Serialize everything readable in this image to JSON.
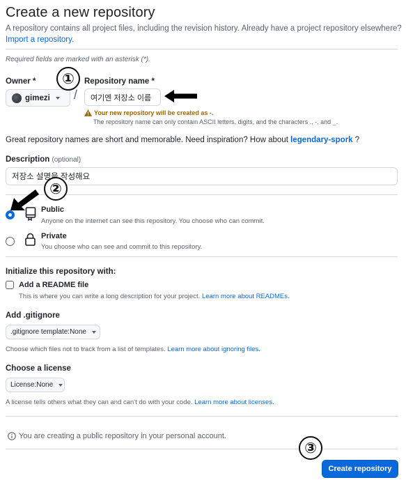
{
  "header": {
    "title": "Create a new repository",
    "intro": "A repository contains all project files, including the revision history. Already have a project repository elsewhere?",
    "import_link": "Import a repository."
  },
  "required_note": "Required fields are marked with an asterisk (*).",
  "owner": {
    "label": "Owner *",
    "value": "gimezi"
  },
  "slash": "/",
  "repo_name": {
    "label": "Repository name *",
    "value": "여기엔 저장소 이름"
  },
  "warning": {
    "main": "Your new repository will be created as -.",
    "sub": "The repository name can only contain ASCII letters, digits, and the characters ., -, and _."
  },
  "suggestion": {
    "prefix": "Great repository names are short and memorable. Need inspiration? How about ",
    "name": "legendary-spork",
    "suffix": " ?"
  },
  "description": {
    "label": "Description",
    "optional": "(optional)",
    "value": "저장소 설명을 작성해요"
  },
  "visibility": {
    "public": {
      "title": "Public",
      "desc": "Anyone on the internet can see this repository. You choose who can commit.",
      "selected": true
    },
    "private": {
      "title": "Private",
      "desc": "You choose who can see and commit to this repository.",
      "selected": false
    }
  },
  "init": {
    "heading": "Initialize this repository with:",
    "readme_label": "Add a README file",
    "readme_desc": "This is where you can write a long description for your project.",
    "readme_link": "Learn more about READMEs."
  },
  "gitignore": {
    "heading": "Add .gitignore",
    "select_prefix": ".gitignore template:",
    "select_value": "None",
    "desc": "Choose which files not to track from a list of templates.",
    "link": "Learn more about ignoring files."
  },
  "license": {
    "heading": "Choose a license",
    "select_prefix": "License:",
    "select_value": "None",
    "desc": "A license tells others what they can and can't do with your code.",
    "link": "Learn more about licenses."
  },
  "notice": "You are creating a public repository in your personal account.",
  "submit_label": "Create repository",
  "annotations": {
    "step1": "①",
    "step2": "②",
    "step3": "③"
  },
  "colors": {
    "accent": "#0969da",
    "warning": "#9a6700",
    "border": "#d1d9e0"
  }
}
